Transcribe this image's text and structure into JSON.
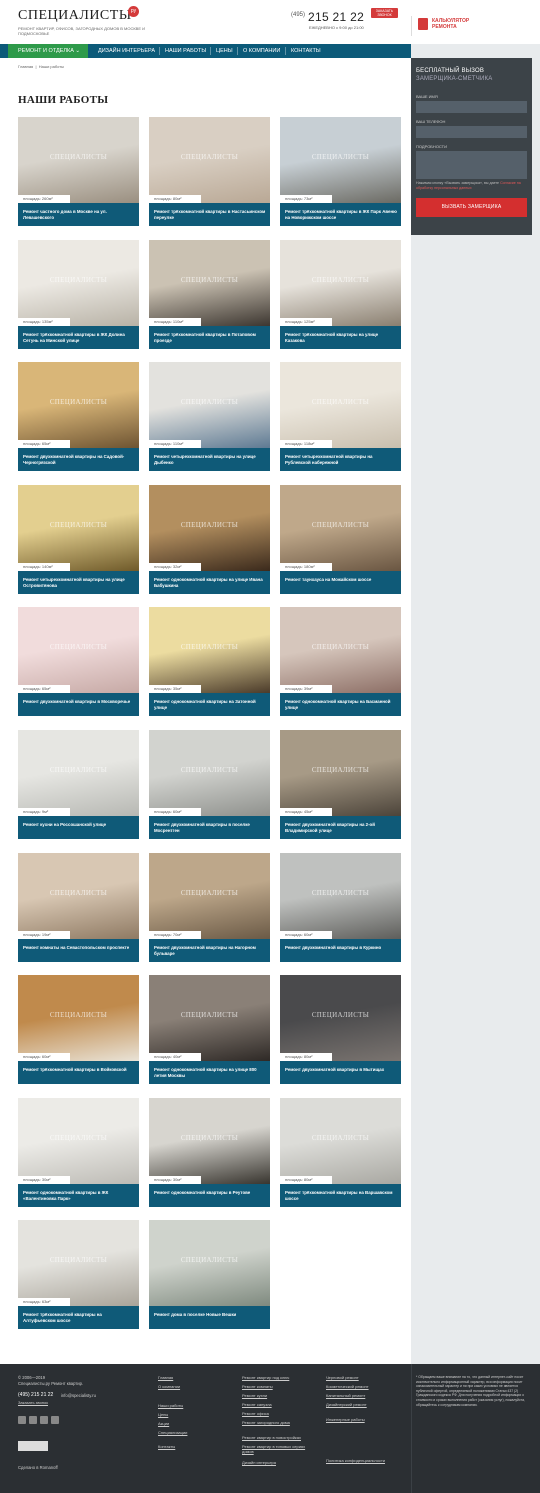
{
  "header": {
    "logo": "СПЕЦИАЛИСТЫ",
    "logo_badge": "ру",
    "tagline": "РЕМОНТ КВАРТИР, ОФИСОВ, ЗАГОРОДНЫХ ДОМОВ В МОСКВЕ И ПОДМОСКОВЬЕ",
    "phone_code": "(495)",
    "phone_number": "215 21 22",
    "call_button": "ЗАКАЗАТЬ ЗВОНОК",
    "hours": "ЕЖЕДНЕВНО с 9:00 до 21:00",
    "calculator": "КАЛЬКУЛЯТОР РЕМОНТА"
  },
  "nav": {
    "items": [
      "РЕМОНТ И ОТДЕЛКА",
      "ДИЗАЙН ИНТЕРЬЕРА",
      "НАШИ РАБОТЫ",
      "ЦЕНЫ",
      "О КОМПАНИИ",
      "КОНТАКТЫ"
    ]
  },
  "breadcrumb": {
    "home": "Главная",
    "sep": "|",
    "current": "Наши работы"
  },
  "page_title": "НАШИ РАБОТЫ",
  "watermark": "СПЕЦИАЛИСТЫ",
  "area_label": "площадь:",
  "projects": [
    {
      "area": "260м²",
      "title": "Ремонт частного дома в Москве на ул. Левашевского",
      "colors": [
        "#d8d4cc",
        "#9a8f80"
      ]
    },
    {
      "area": "80м²",
      "title": "Ремонт трёхкомнатной квартиры в Настасьинском переулке",
      "colors": [
        "#d9cfc3",
        "#b9a895"
      ]
    },
    {
      "area": "73м²",
      "title": "Ремонт трёхкомнатной квартиры в ЖК Парк Авеню на Новорижском шоссе",
      "colors": [
        "#c7cfd4",
        "#6b6a63"
      ]
    },
    {
      "area": "135м²",
      "title": "Ремонт трёхкомнатной квартиры в ЖК Долина Сетунь на Минской улице",
      "colors": [
        "#ece9e3",
        "#b8b2a6"
      ]
    },
    {
      "area": "110м²",
      "title": "Ремонт трёхкомнатной квартиры в Потаповом проезде",
      "colors": [
        "#cbc2b3",
        "#3c3630"
      ]
    },
    {
      "area": "125м²",
      "title": "Ремонт трёхкомнатной квартиры на улице Казакова",
      "colors": [
        "#e6e2db",
        "#8a7f70"
      ]
    },
    {
      "area": "65м²",
      "title": "Ремонт двухкомнатной квартиры на Садовой-Черногрязской",
      "colors": [
        "#d9b678",
        "#6e5432"
      ]
    },
    {
      "area": "110м²",
      "title": "Ремонт четырехкомнатной квартиры на улице Дыбенко",
      "colors": [
        "#e3e2de",
        "#5e7a93"
      ]
    },
    {
      "area": "118м²",
      "title": "Ремонт четырехкомнатной квартиры на Рублевской набережной",
      "colors": [
        "#ebe6dc",
        "#c9bfae"
      ]
    },
    {
      "area": "140м²",
      "title": "Ремонт четырехкомнатной квартиры на улице Островитянова",
      "colors": [
        "#e3cf8f",
        "#6f5a2a"
      ]
    },
    {
      "area": "32м²",
      "title": "Ремонт однокомнатной квартиры на улице Ивана Бабушкина",
      "colors": [
        "#b38f5f",
        "#3b2a1c"
      ]
    },
    {
      "area": "180м²",
      "title": "Ремонт таунхауса на Можайском шоссе",
      "colors": [
        "#bfa88a",
        "#6a5642"
      ]
    },
    {
      "area": "65м²",
      "title": "Ремонт двухкомнатной квартиры в Москворечье",
      "colors": [
        "#f1dcdc",
        "#c6a9a5"
      ]
    },
    {
      "area": "35м²",
      "title": "Ремонт однокомнатной квартиры на Затонной улице",
      "colors": [
        "#ecdca0",
        "#4b3b2a"
      ]
    },
    {
      "area": "39м²",
      "title": "Ремонт однокомнатной квартиры на Басманной улице",
      "colors": [
        "#d6c6bc",
        "#8d6f66"
      ]
    },
    {
      "area": "9м²",
      "title": "Ремонт кухни на Россошанской улице",
      "colors": [
        "#e6e6e2",
        "#b7b8b3"
      ]
    },
    {
      "area": "60м²",
      "title": "Ремонт двухкомнатной квартиры в поселке Мосрентген",
      "colors": [
        "#d2d3cf",
        "#8f918d"
      ]
    },
    {
      "area": "45м²",
      "title": "Ремонт двухкомнатной квартиры на 2-ой Владимирской улице",
      "colors": [
        "#a79a86",
        "#4c443a"
      ]
    },
    {
      "area": "19м²",
      "title": "Ремонт комнаты на Севастопольском проспекте",
      "colors": [
        "#d8c7b3",
        "#8f7a63"
      ]
    },
    {
      "area": "70м²",
      "title": "Ремонт двухкомнатной квартиры на Нагорном бульваре",
      "colors": [
        "#bda78a",
        "#6b5a46"
      ]
    },
    {
      "area": "60м²",
      "title": "Ремонт двухкомнатной квартиры в Куркино",
      "colors": [
        "#bfc1bf",
        "#5e5e5b"
      ]
    },
    {
      "area": "60м²",
      "title": "Ремонт трёхкомнатной квартиры в Войковской",
      "colors": [
        "#c08a4c",
        "#e9e3d7"
      ]
    },
    {
      "area": "40м²",
      "title": "Ремонт однокомнатной квартиры на улице 800 летия Москвы",
      "colors": [
        "#8a8077",
        "#2e2926"
      ]
    },
    {
      "area": "80м²",
      "title": "Ремонт двухкомнатной квартиры в Мытищах",
      "colors": [
        "#4a4a4c",
        "#7a7470"
      ]
    },
    {
      "area": "30м²",
      "title": "Ремонт однокомнатной квартиры в ЖК «Валентиновка Парк»",
      "colors": [
        "#ecebe7",
        "#bdbbb5"
      ]
    },
    {
      "area": "30м²",
      "title": "Ремонт однокомнатной квартиры в Реутове",
      "colors": [
        "#d7d5cf",
        "#38352f"
      ]
    },
    {
      "area": "80м²",
      "title": "Ремонт трёхкомнатной квартиры на Варшавском шоссе",
      "colors": [
        "#dcdcd8",
        "#a9a8a2"
      ]
    },
    {
      "area": "63м²",
      "title": "Ремонт трёхкомнатной квартиры на Алтуфьевском шоссе",
      "colors": [
        "#e4e3de",
        "#a9a49a"
      ]
    },
    {
      "area": "",
      "title": "Ремонт дома в поселке Новые Вешки",
      "colors": [
        "#cfd3cc",
        "#7f8a7f"
      ]
    }
  ],
  "callback": {
    "title": "БЕСПЛАТНЫЙ ВЫЗОВ",
    "subtitle": "ЗАМЕРЩИКА-СМЕТЧИКА",
    "name_label": "ВАШЕ ИМЯ",
    "phone_label": "ВАШ ТЕЛЕФОН",
    "details_label": "ПОДРОБНОСТИ",
    "note": "Нажимая кнопку «Вызвать замерщика», вы даете",
    "note_link": "Согласие на обработку персональных данных",
    "button": "ВЫЗВАТЬ ЗАМЕРЩИКА"
  },
  "footer": {
    "copyright": "© 2006—2019",
    "company": "Специалисты.ру  Ремонт квартир.",
    "phone": "(495) 215 21 22",
    "email": "info@specialisty.ru",
    "order_call": "Заказать звонок",
    "counter_label": "Сделано в  Romanoff",
    "col1": [
      "Главная",
      "О компании",
      "Наши работы",
      "Цены",
      "Акции",
      "Специализации",
      "Контакты"
    ],
    "col2": [
      "Ремонт квартир под ключ",
      "Ремонт комнаты",
      "Ремонт кухни",
      "Ремонт санузла",
      "Ремонт офиса",
      "Ремонт загородного дома",
      "Ремонт квартир в новостройках",
      "Ремонт квартир в типовых сериях домов",
      "Дизайн интерьера"
    ],
    "col3": [
      "Черновой ремонт",
      "Косметический ремонт",
      "Капитальный ремонт",
      "Дизайнерский ремонт",
      "Инженерные работы",
      "Политика конфиденциальности"
    ],
    "disclaimer": "* Обращаем ваше внимание на то, что данный интернет-сайт носит исключительно информационный характер, вся информация носит ознакомительный характер и ни при каких условиях не является публичной офертой, определяемой положениями Статьи 437 (2) Гражданского кодекса РФ. Для получения подробной информации о стоимости и сроках выполнения работ (оказания услуг), пожалуйста, обращайтесь к сотрудникам компании."
  }
}
